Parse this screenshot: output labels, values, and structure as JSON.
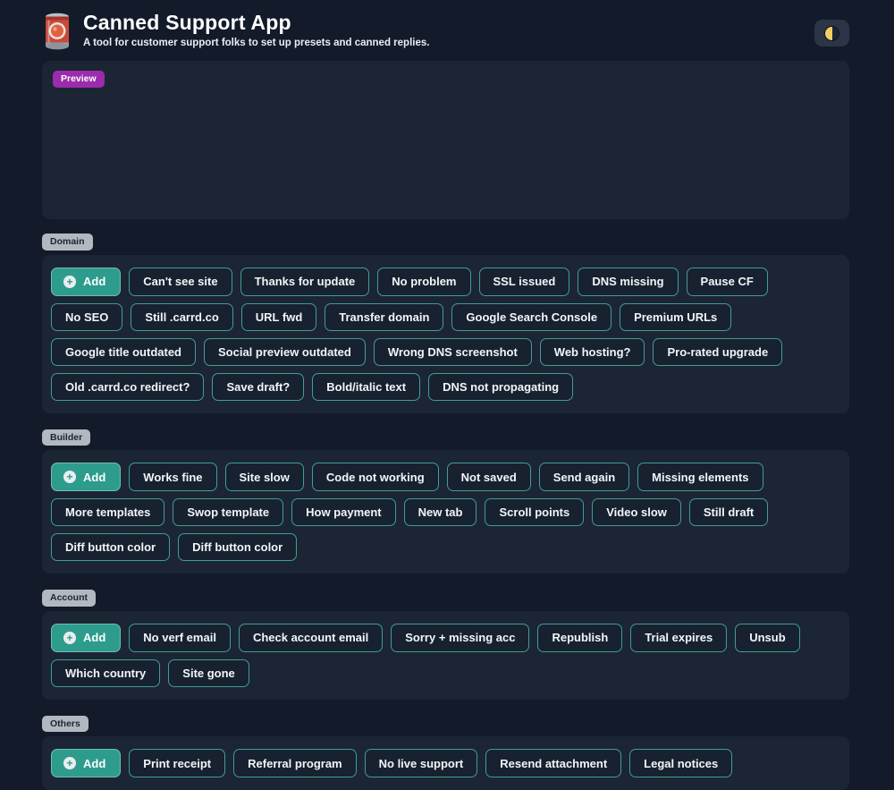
{
  "header": {
    "title": "Canned Support App",
    "subtitle": "A tool for customer support folks to set up presets and canned replies.",
    "app_icon": "canned-food-icon",
    "theme_toggle_icon": "half-moon-icon"
  },
  "preview": {
    "label": "Preview"
  },
  "colors": {
    "page_bg": "#131b2a",
    "panel_bg": "#1c2534",
    "chip_border_teal": "#3f9e92",
    "add_button_teal": "#2e9c8c",
    "preview_badge_purple": "#9c2bad",
    "section_badge_gray": "#b3b8c0",
    "moon_yellow": "#f2cf63"
  },
  "add_button_label": "Add",
  "sections": [
    {
      "label": "Domain",
      "chips": [
        "Can't see site",
        "Thanks for update",
        "No problem",
        "SSL issued",
        "DNS missing",
        "Pause CF",
        "No SEO",
        "Still .carrd.co",
        "URL fwd",
        "Transfer domain",
        "Google Search Console",
        "Premium URLs",
        "Google title outdated",
        "Social preview outdated",
        "Wrong DNS screenshot",
        "Web hosting?",
        "Pro-rated upgrade",
        "Old .carrd.co redirect?",
        "Save draft?",
        "Bold/italic text",
        "DNS not propagating"
      ]
    },
    {
      "label": "Builder",
      "chips": [
        "Works fine",
        "Site slow",
        "Code not working",
        "Not saved",
        "Send again",
        "Missing elements",
        "More templates",
        "Swop template",
        "How payment",
        "New tab",
        "Scroll points",
        "Video slow",
        "Still draft",
        "Diff button color",
        "Diff button color"
      ]
    },
    {
      "label": "Account",
      "chips": [
        "No verf email",
        "Check account email",
        "Sorry + missing acc",
        "Republish",
        "Trial expires",
        "Unsub",
        "Which country",
        "Site gone"
      ]
    },
    {
      "label": "Others",
      "chips": [
        "Print receipt",
        "Referral program",
        "No live support",
        "Resend attachment",
        "Legal notices"
      ]
    }
  ]
}
